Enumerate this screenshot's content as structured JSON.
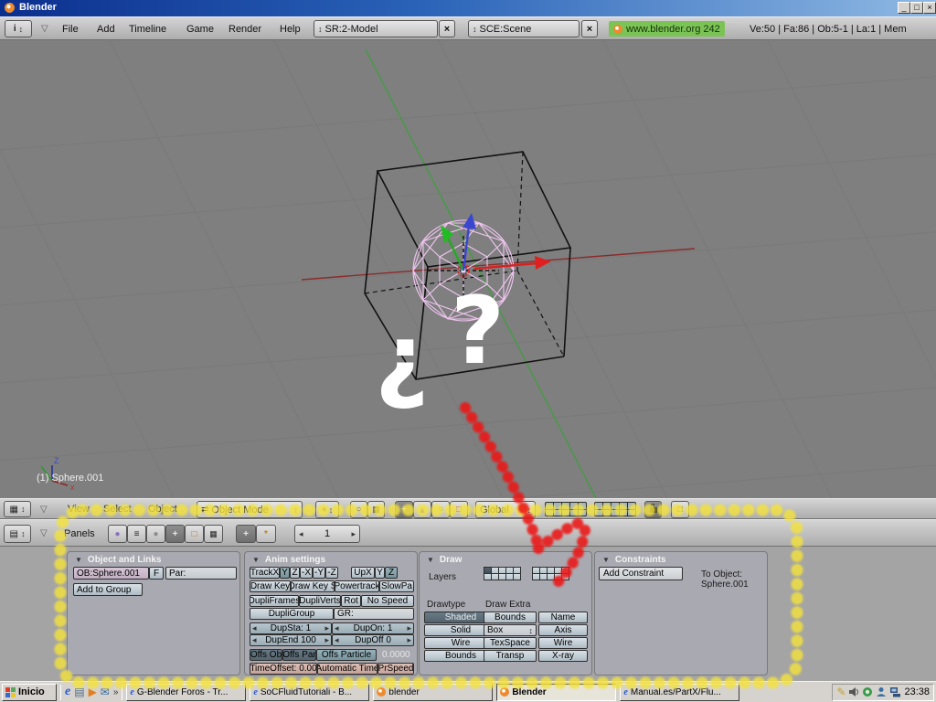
{
  "colors": {
    "select_teal": "#7f9da6",
    "panel_bg": "#a9a9b1",
    "badge_green": "#7cc356",
    "annotation_yellow": "#f4e23c",
    "annotation_red": "#ec1414",
    "viewport_grey": "#7f7f7f"
  },
  "icons": {
    "updown": "↕",
    "close": "×",
    "collapse": "▼",
    "collapse_open": "▽",
    "left": "◂",
    "right": "▸",
    "grid": "▦",
    "list": "▤",
    "info": "i",
    "circle": "●",
    "square": "□",
    "plus": "+",
    "triangle": "▲",
    "script": "≡",
    "chevron": "»",
    "ie": "e",
    "mail": "✉",
    "play": "▶",
    "pen": "✎",
    "swap": "⇄",
    "ring": "○",
    "minimize": "_",
    "restore": "□",
    "star": "*"
  },
  "titlebar": {
    "title": "Blender"
  },
  "menubar": {
    "menus": [
      "File",
      "Add",
      "Timeline",
      "Game",
      "Render",
      "Help"
    ],
    "screen_selector": "SR:2-Model",
    "scene_selector": "SCE:Scene",
    "badge": "www.blender.org 242",
    "stats": "Ve:50 | Fa:86 | Ob:5-1 | La:1 | Mem"
  },
  "viewport": {
    "object_label": "(1) Sphere.001",
    "question_open": "¿",
    "question_close": "?",
    "axis_z": "Z",
    "axis_x": "x"
  },
  "viewport_header": {
    "menus": [
      "View",
      "Select",
      "Object"
    ],
    "mode": "Object Mode",
    "orientation": "Global"
  },
  "buttons_header": {
    "label": "Panels",
    "frame": "1"
  },
  "panels": {
    "object_links": {
      "title": "Object and Links",
      "ob": "OB:Sphere.001",
      "f": "F",
      "par": "Par:",
      "add_group": "Add to Group"
    },
    "anim": {
      "title": "Anim settings",
      "track": [
        "TrackX",
        "Y",
        "Z",
        "-X",
        "-Y",
        "-Z"
      ],
      "up": [
        "UpX",
        "Y",
        "Z"
      ],
      "keys": [
        "Draw Key",
        "Draw Key S",
        "Powertrack",
        "SlowPa"
      ],
      "dupli": [
        "DupliFrames",
        "DupliVerts",
        "Rot",
        "No Speed"
      ],
      "group": [
        "DupliGroup",
        "GR:"
      ],
      "dup_fields": [
        "DupSta: 1",
        "DupOn: 1",
        "DupEnd 100",
        "DupOff 0"
      ],
      "offs": [
        "Offs Ob",
        "Offs Par",
        "Offs Particle"
      ],
      "offs_value": "0.0000",
      "time": [
        "TimeOffset: 0.00",
        "Automatic Time",
        "PrSpeed"
      ]
    },
    "draw": {
      "title": "Draw",
      "layers_label": "Layers",
      "drawtype_label": "Drawtype",
      "drawtype": [
        "Shaded",
        "Solid",
        "Wire",
        "Bounds"
      ],
      "extra_label": "Draw Extra",
      "extra_left": [
        "Bounds",
        "Box",
        "TexSpace",
        "Transp"
      ],
      "extra_right": [
        "Name",
        "Axis",
        "Wire",
        "X-ray"
      ]
    },
    "constraints": {
      "title": "Constraints",
      "add": "Add Constraint",
      "to_object": "To Object: Sphere.001"
    }
  },
  "taskbar": {
    "start": "Inicio",
    "tasks": [
      "G-Blender Foros - Tr...",
      "SoCFluidTutoriali - B...",
      "blender",
      "Blender",
      "Manual.es/PartX/Flu..."
    ],
    "clock": "23:38"
  }
}
